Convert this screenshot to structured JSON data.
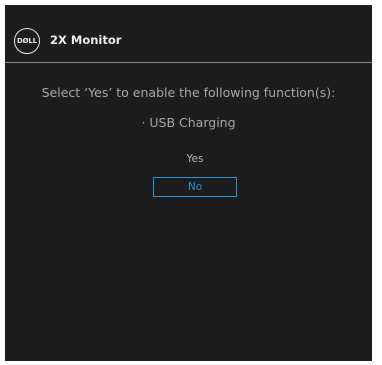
{
  "header": {
    "logo_text": "DØLL",
    "title": "2X Monitor"
  },
  "dialog": {
    "prompt": "Select ‘Yes’ to enable the following function(s):",
    "function_item": "· USB Charging",
    "options": [
      {
        "label": "Yes",
        "selected": false
      },
      {
        "label": "No",
        "selected": true
      }
    ]
  },
  "colors": {
    "background": "#1d1d1d",
    "text": "#a7a7a7",
    "accent": "#2a93d5",
    "divider": "#8a8a8a"
  }
}
